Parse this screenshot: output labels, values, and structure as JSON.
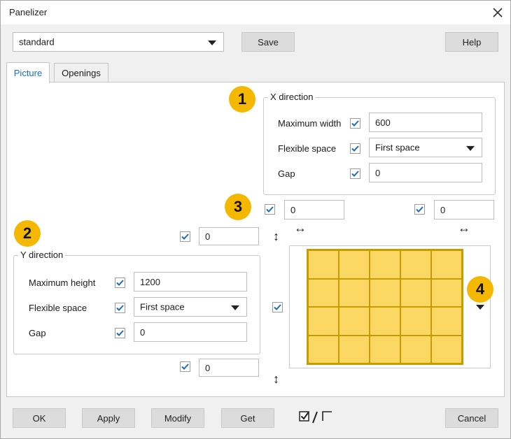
{
  "window": {
    "title": "Panelizer"
  },
  "toolbar": {
    "preset_value": "standard",
    "save_label": "Save",
    "help_label": "Help"
  },
  "tabs": [
    {
      "label": "Picture",
      "active": true
    },
    {
      "label": "Openings",
      "active": false
    }
  ],
  "x_direction": {
    "title": "X direction",
    "max_width_label": "Maximum width",
    "max_width_value": "600",
    "flexible_label": "Flexible space",
    "flexible_value": "First space",
    "gap_label": "Gap",
    "gap_value": "0"
  },
  "y_direction": {
    "title": "Y direction",
    "max_height_label": "Maximum height",
    "max_height_value": "1200",
    "flexible_label": "Flexible space",
    "flexible_value": "First space",
    "gap_label": "Gap",
    "gap_value": "0"
  },
  "offsets": {
    "left_x": "0",
    "right_x": "0",
    "top_y": "0",
    "bottom_y": "0"
  },
  "badges": [
    "1",
    "2",
    "3",
    "4"
  ],
  "buttons": {
    "ok": "OK",
    "apply": "Apply",
    "modify": "Modify",
    "get": "Get",
    "cancel": "Cancel"
  },
  "icons": {
    "close": "close-icon",
    "check": "checkmark-icon",
    "horizontal_arrow": "horizontal-double-arrow-icon",
    "vertical_arrow": "vertical-double-arrow-icon",
    "toggle_all": "check-uncheck-all-icon"
  },
  "colors": {
    "accent": "#1c6fb8",
    "badge": "#f5b800",
    "panel_fill": "#fbd764",
    "panel_border": "#c69c00"
  },
  "preview": {
    "columns": 5,
    "rows": 4
  }
}
